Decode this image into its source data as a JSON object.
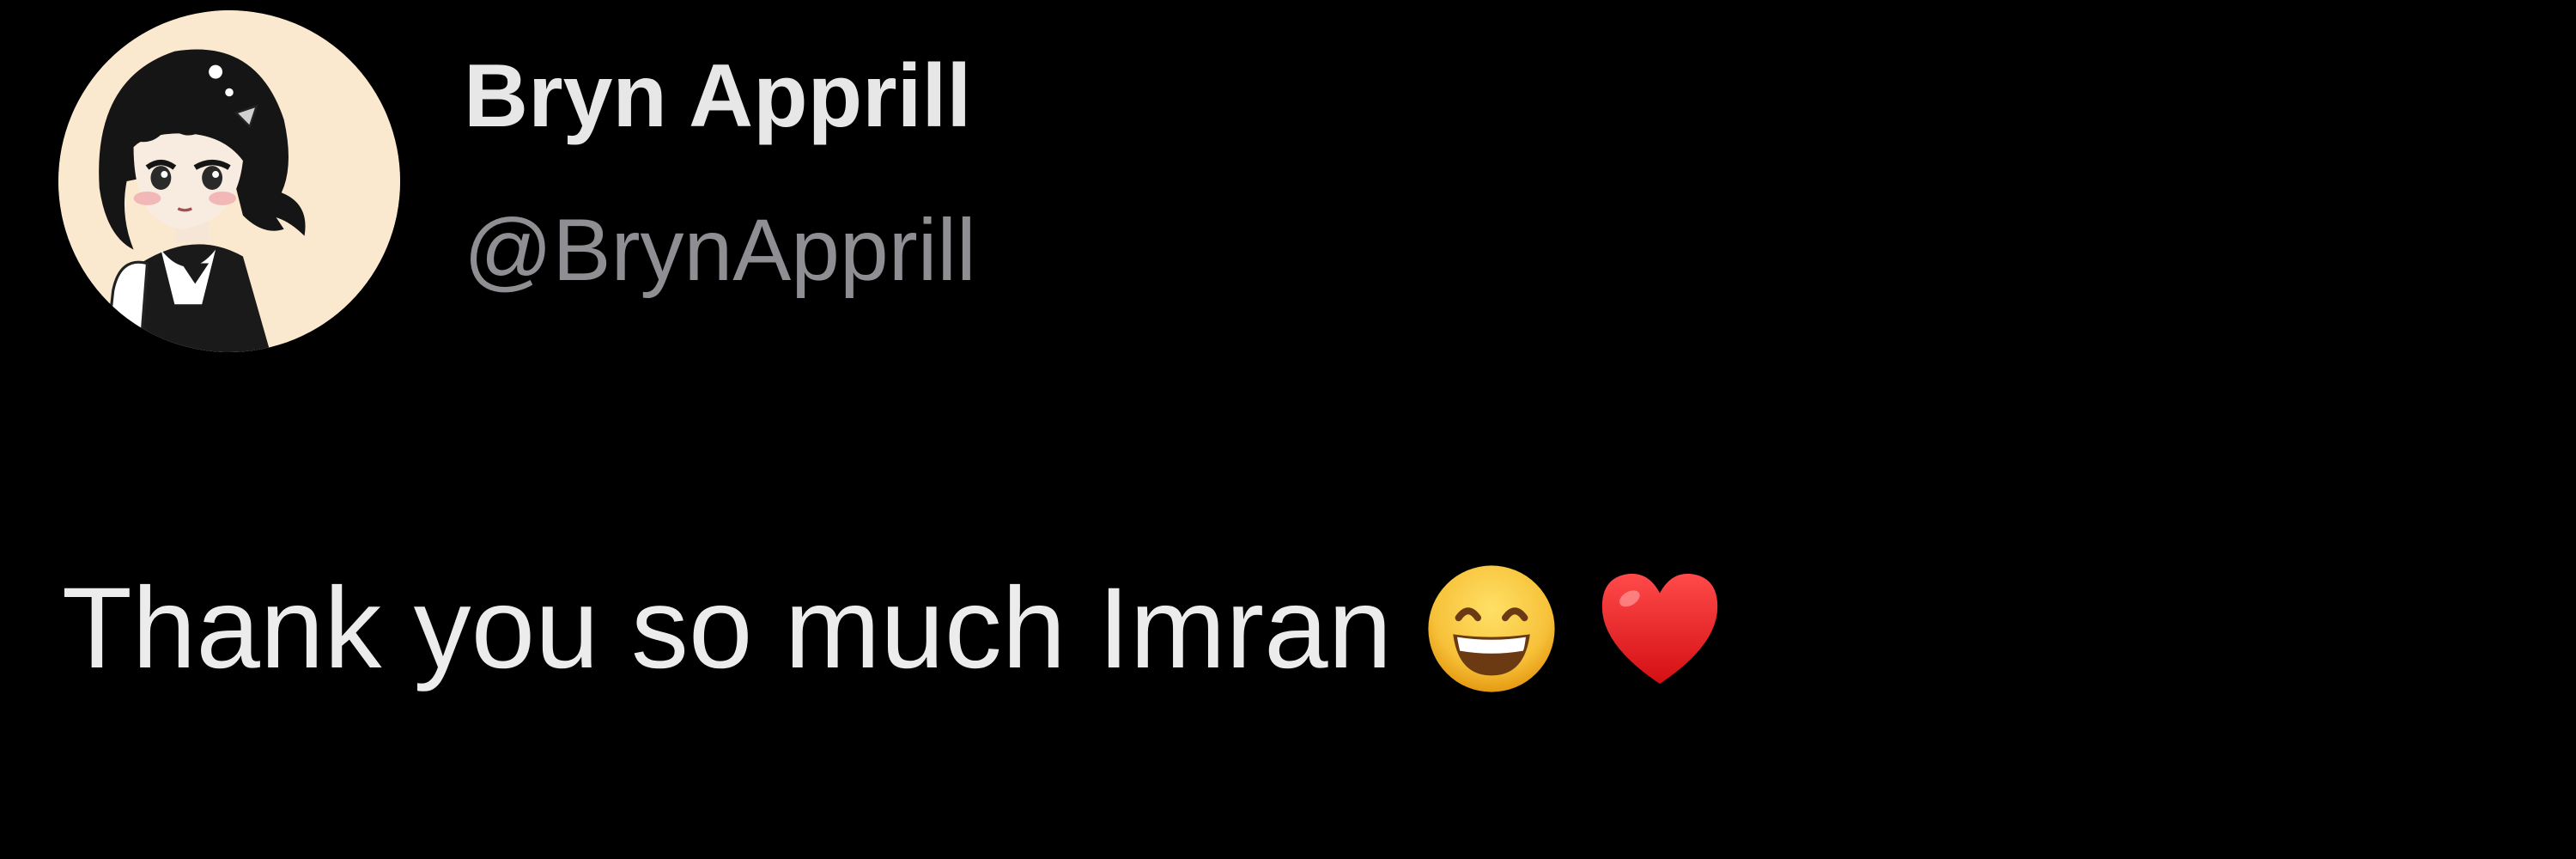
{
  "tweet": {
    "author": {
      "display_name": "Bryn Apprill",
      "handle": "@BrynApprill",
      "avatar_icon": "anime-girl-avatar-icon"
    },
    "text": "Thank you so much Imran",
    "emojis": [
      {
        "icon": "grinning-face-smiling-eyes-icon",
        "glyph": "😄"
      },
      {
        "icon": "red-heart-icon",
        "glyph": "❤️"
      }
    ]
  },
  "colors": {
    "background": "#000000",
    "display_name": "#e7e7e7",
    "handle": "#8e8e93",
    "text": "#ececec",
    "avatar_bg": "#fbe9cf"
  }
}
